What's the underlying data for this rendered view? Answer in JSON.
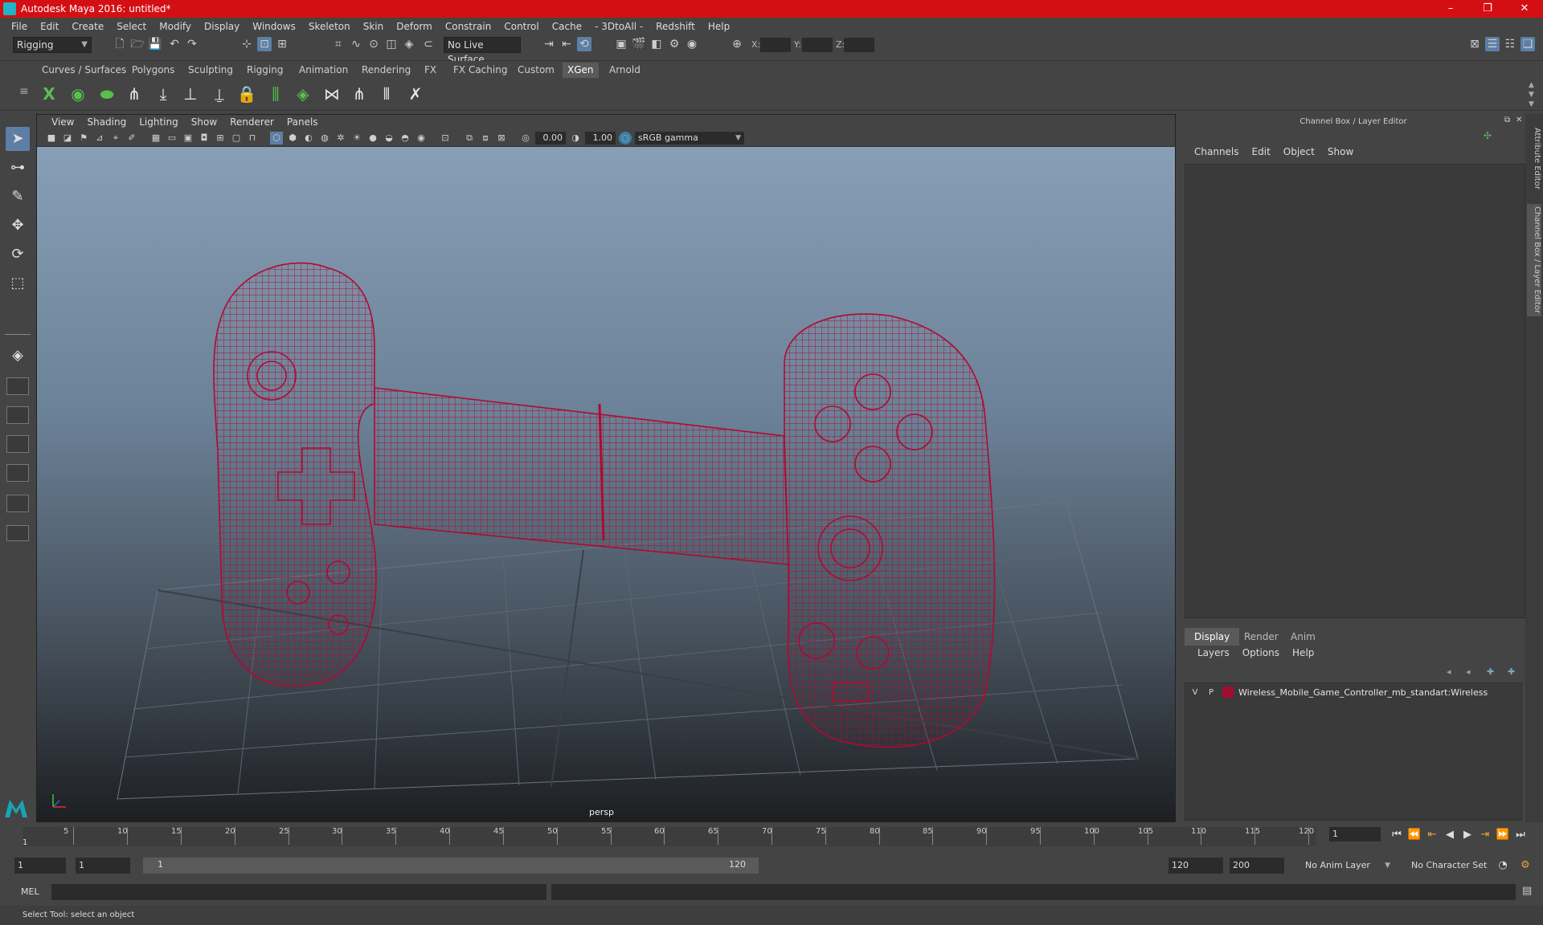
{
  "window": {
    "title": "Autodesk Maya 2016: untitled*",
    "controls": [
      "–",
      "❐",
      "✕"
    ]
  },
  "menubar": [
    "File",
    "Edit",
    "Create",
    "Select",
    "Modify",
    "Display",
    "Windows",
    "Skeleton",
    "Skin",
    "Deform",
    "Constrain",
    "Control",
    "Cache",
    "- 3DtoAll -",
    "Redshift",
    "Help"
  ],
  "statusline": {
    "mode": "Rigging",
    "live_surface": "No Live Surface",
    "coord_x_label": "X:",
    "coord_y_label": "Y:",
    "coord_z_label": "Z:"
  },
  "shelf": {
    "tabs": [
      "Curves / Surfaces",
      "Polygons",
      "Sculpting",
      "Rigging",
      "Animation",
      "Rendering",
      "FX",
      "FX Caching",
      "Custom",
      "XGen",
      "Arnold"
    ],
    "selected_tab": "XGen"
  },
  "viewport": {
    "menu": [
      "View",
      "Shading",
      "Lighting",
      "Show",
      "Renderer",
      "Panels"
    ],
    "exposure": "0.00",
    "gamma": "1.00",
    "color_space": "sRGB gamma",
    "camera": "persp",
    "wire_color": "#b00a30"
  },
  "channelbox": {
    "title": "Channel Box / Layer Editor",
    "menu": [
      "Channels",
      "Edit",
      "Object",
      "Show"
    ]
  },
  "layereditor": {
    "tabs": [
      "Display",
      "Render",
      "Anim"
    ],
    "menu": [
      "Layers",
      "Options",
      "Help"
    ],
    "layer": {
      "v": "V",
      "p": "P",
      "name": "Wireless_Mobile_Game_Controller_mb_standart:Wireless",
      "color": "#a10d2e"
    }
  },
  "sidetabs": [
    "Attribute Editor",
    "Channel Box / Layer Editor"
  ],
  "timeline": {
    "ticks": [
      "5",
      "10",
      "15",
      "20",
      "25",
      "30",
      "35",
      "40",
      "45",
      "50",
      "55",
      "60",
      "65",
      "70",
      "75",
      "80",
      "85",
      "90",
      "95",
      "100",
      "105",
      "110",
      "115",
      "120"
    ],
    "current_frame": "1",
    "start_marker": "1"
  },
  "range": {
    "start": "1",
    "playback_start": "1",
    "bar_start": "1",
    "bar_end": "120",
    "playback_end": "120",
    "end": "200",
    "anim_layer": "No Anim Layer",
    "character_set": "No Character Set"
  },
  "command": {
    "label": "MEL"
  },
  "helpline": "Select Tool: select an object"
}
